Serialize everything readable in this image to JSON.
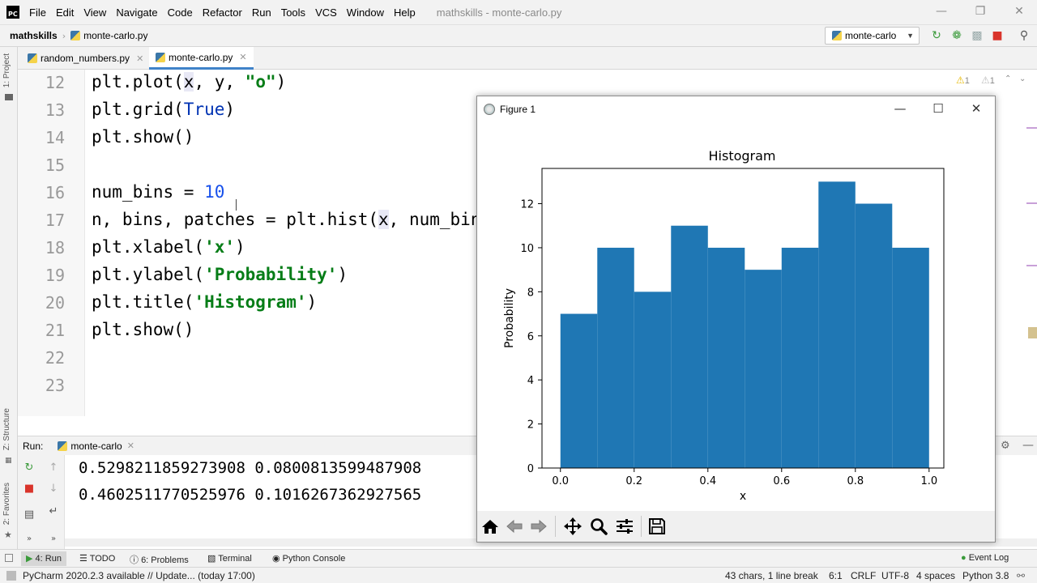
{
  "menubar": {
    "items": [
      "File",
      "Edit",
      "View",
      "Navigate",
      "Code",
      "Refactor",
      "Run",
      "Tools",
      "VCS",
      "Window",
      "Help"
    ],
    "window_title": "mathskills - monte-carlo.py"
  },
  "navbar": {
    "project": "mathskills",
    "file": "monte-carlo.py",
    "run_config": "monte-carlo"
  },
  "left_strip": {
    "project_label": "1: Project",
    "structure_label": "Z: Structure",
    "favorites_label": "2: Favorites"
  },
  "editor_tabs": [
    {
      "label": "random_numbers.py",
      "active": false
    },
    {
      "label": "monte-carlo.py",
      "active": true
    }
  ],
  "editor": {
    "line_numbers": [
      "12",
      "13",
      "14",
      "15",
      "16",
      "17",
      "18",
      "19",
      "20",
      "21",
      "22",
      "23"
    ],
    "warnings": {
      "yellow_count": "1",
      "gray_count": "1"
    }
  },
  "run_panel": {
    "label": "Run:",
    "tab": "monte-carlo",
    "output": [
      "0.5298211859273908 0.0800813599487908",
      "0.4602511770525976 0.1016267362927565"
    ]
  },
  "bottom_tools": {
    "run": "4: Run",
    "todo": "TODO",
    "problems": "6: Problems",
    "terminal": "Terminal",
    "python_console": "Python Console",
    "event_log": "Event Log"
  },
  "status_bar": {
    "message": "PyCharm 2020.2.3 available // Update... (today 17:00)",
    "chars": "43 chars, 1 line break",
    "position": "6:1",
    "line_sep": "CRLF",
    "encoding": "UTF-8",
    "indent": "4 spaces",
    "interpreter": "Python 3.8"
  },
  "figure": {
    "window_title": "Figure 1"
  },
  "chart_data": {
    "type": "bar",
    "title": "Histogram",
    "xlabel": "x",
    "ylabel": "Probability",
    "bin_edges": [
      0.0,
      0.1,
      0.2,
      0.3,
      0.4,
      0.5,
      0.6,
      0.7,
      0.8,
      0.9,
      1.0
    ],
    "values": [
      7,
      10,
      8,
      11,
      10,
      9,
      10,
      13,
      12,
      10
    ],
    "xlim": [
      -0.05,
      1.04
    ],
    "ylim": [
      0,
      13.6
    ],
    "xticks": [
      "0.0",
      "0.2",
      "0.4",
      "0.6",
      "0.8",
      "1.0"
    ],
    "yticks": [
      "0",
      "2",
      "4",
      "6",
      "8",
      "10",
      "12"
    ],
    "bar_color": "#1f77b4",
    "grid": false
  }
}
